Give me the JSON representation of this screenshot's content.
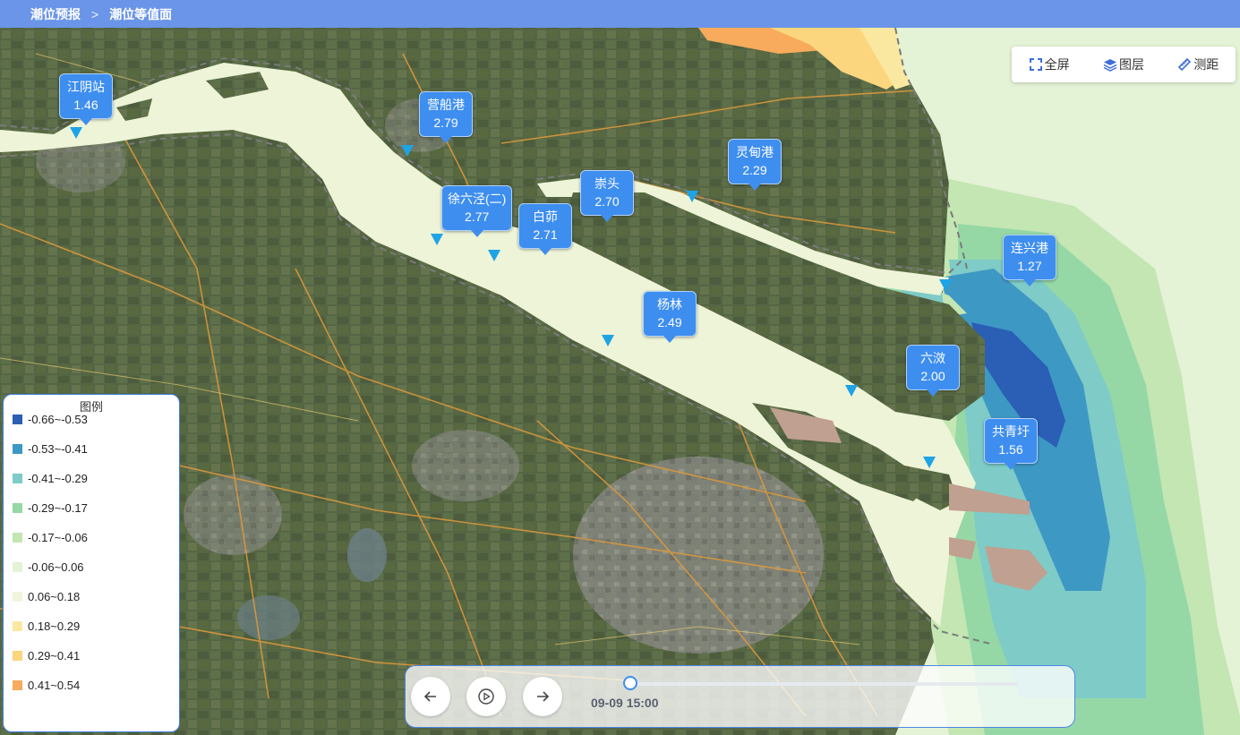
{
  "breadcrumb": {
    "root": "潮位预报",
    "separator": ">",
    "current": "潮位等值面"
  },
  "toolbar": {
    "fullscreen": "全屏",
    "layers": "图层",
    "measure": "测距"
  },
  "stations": [
    {
      "name": "江阴站",
      "value": "1.46"
    },
    {
      "name": "营船港",
      "value": "2.79"
    },
    {
      "name": "徐六泾(二)",
      "value": "2.77"
    },
    {
      "name": "白茆",
      "value": "2.71"
    },
    {
      "name": "崇头",
      "value": "2.70"
    },
    {
      "name": "灵甸港",
      "value": "2.29"
    },
    {
      "name": "杨林",
      "value": "2.49"
    },
    {
      "name": "连兴港",
      "value": "1.27"
    },
    {
      "name": "六滧",
      "value": "2.00"
    },
    {
      "name": "共青圩",
      "value": "1.56"
    }
  ],
  "legend": {
    "title": "图例",
    "items": [
      {
        "label": "-0.66~-0.53",
        "color": "#2a5fb5"
      },
      {
        "label": "-0.53~-0.41",
        "color": "#3e98c4"
      },
      {
        "label": "-0.41~-0.29",
        "color": "#7ecbc7"
      },
      {
        "label": "-0.29~-0.17",
        "color": "#95d8a6"
      },
      {
        "label": "-0.17~-0.06",
        "color": "#c3e6b3"
      },
      {
        "label": "-0.06~0.06",
        "color": "#e4f2d6"
      },
      {
        "label": "0.06~0.18",
        "color": "#f1f5dc"
      },
      {
        "label": "0.18~0.29",
        "color": "#fbe8a0"
      },
      {
        "label": "0.29~0.41",
        "color": "#fcd57f"
      },
      {
        "label": "0.41~0.54",
        "color": "#f8ab5c"
      }
    ]
  },
  "player": {
    "time": "09-09 15:00",
    "progress": 0.01
  }
}
